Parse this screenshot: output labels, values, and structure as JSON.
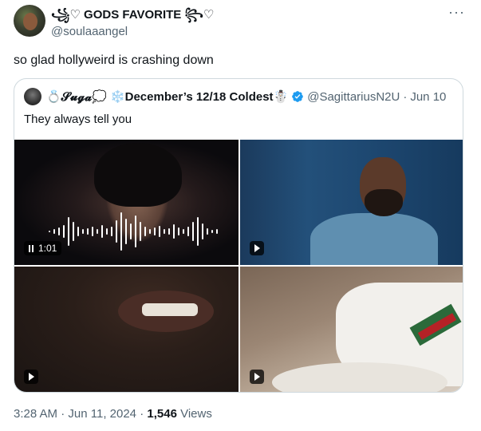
{
  "tweet": {
    "display_name": "꧁♡ GODS FAVORITE ꧂♡",
    "handle": "@soulaaangel",
    "text": "so glad hollyweird is crashing down",
    "more_label": "···"
  },
  "quote": {
    "display_name": "💍𝓢𝓾𝓰𝓪💭 ❄️December’s 12/18 Coldest☃️",
    "handle": "@SagittariusN2U",
    "separator": "·",
    "date": "Jun 10",
    "text": "They always tell you",
    "media": [
      {
        "label": "1:01",
        "kind": "audio-video"
      },
      {
        "kind": "video"
      },
      {
        "kind": "video"
      },
      {
        "kind": "video"
      }
    ]
  },
  "meta": {
    "time": "3:28 AM",
    "separator1": " · ",
    "date": "Jun 11, 2024",
    "separator2": " · ",
    "views_count": "1,546",
    "views_label": " Views"
  },
  "colors": {
    "text": "#0f1419",
    "secondary": "#536471",
    "verified": "#1d9bf0",
    "border": "#cfd9de"
  }
}
